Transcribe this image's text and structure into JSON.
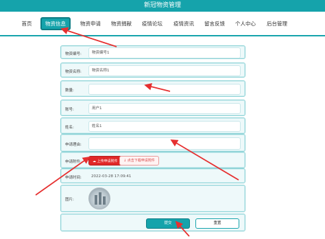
{
  "app": {
    "title": "新冠物资管理"
  },
  "nav": {
    "items": [
      "首页",
      "物资信息",
      "物资申请",
      "物资捐献",
      "疫情论坛",
      "疫情资讯",
      "留言反馈",
      "个人中心",
      "后台管理"
    ],
    "active_index": 1
  },
  "form": {
    "code": {
      "label": "物资编号:",
      "value": "物资编号1"
    },
    "name": {
      "label": "物资名称:",
      "value": "物资名称1"
    },
    "quantity": {
      "label": "数量:",
      "value": ""
    },
    "account": {
      "label": "账号:",
      "value": "用户1"
    },
    "realname": {
      "label": "姓名:",
      "value": "姓名1"
    },
    "reason": {
      "label": "申请理由:",
      "value": ""
    },
    "attachment": {
      "label": "申请附件:",
      "upload_label": "上传申请附件",
      "download_label": "点击下载申请附件"
    },
    "time": {
      "label": "申请时间:",
      "value": "2022-03-28 17:09:41"
    },
    "image": {
      "label": "图片:"
    },
    "submit_label": "提交",
    "reset_label": "重置"
  },
  "colors": {
    "primary": "#15a3ab",
    "danger": "#e02828",
    "arrow": "#e63030"
  },
  "icons": {
    "upload": "cloud-upload-icon",
    "download": "download-icon"
  }
}
